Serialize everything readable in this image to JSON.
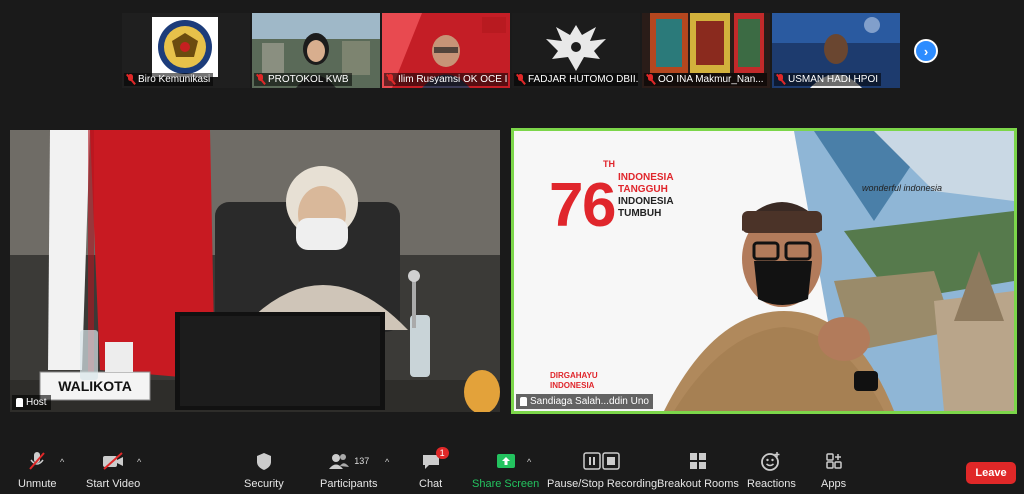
{
  "participants_strip": [
    {
      "name": "Biro Kemunikasi"
    },
    {
      "name": "PROTOKOL KWB"
    },
    {
      "name": "Ilim Rusyamsi OK OCE I..."
    },
    {
      "name": "FADJAR HUTOMO DBII..."
    },
    {
      "name": "OO INA Makmur_Nan..."
    },
    {
      "name": "USMAN HADI HPOI"
    }
  ],
  "main_tiles": {
    "left_label": "Host",
    "left_nameplate": "WALIKOTA",
    "right_label": "Sandiaga Salah...ddin Uno",
    "banner": {
      "number": "76",
      "th": "TH",
      "line1": "INDONESIA",
      "line2": "TANGGUH",
      "line3": "INDONESIA",
      "line4": "TUMBUH",
      "footer1": "DIRGAHAYU",
      "footer2": "INDONESIA",
      "wonderful": "wonderful indonesia"
    }
  },
  "toolbar": {
    "unmute": "Unmute",
    "start_video": "Start Video",
    "security": "Security",
    "participants": "Participants",
    "participants_count": "137",
    "chat": "Chat",
    "chat_badge": "1",
    "share_screen": "Share Screen",
    "pause_recording": "Pause/Stop Recording",
    "breakout_rooms": "Breakout Rooms",
    "reactions": "Reactions",
    "apps": "Apps",
    "leave": "Leave"
  },
  "colors": {
    "accent_blue": "#2d8cff",
    "active_speaker": "#7cd64a",
    "danger": "#e02828",
    "share_green": "#23c35f"
  }
}
